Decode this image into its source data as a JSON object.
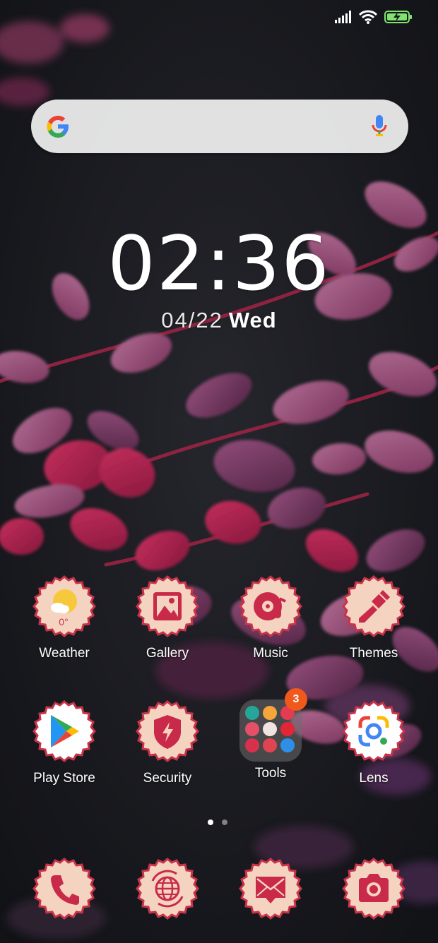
{
  "status_bar": {
    "icons": [
      "signal-icon",
      "wifi-icon",
      "battery-charging-icon"
    ]
  },
  "search": {
    "placeholder": "",
    "logo": "google-g-icon",
    "mic": "mic-icon"
  },
  "clock": {
    "hours": "02",
    "separator": ":",
    "minutes": "36"
  },
  "date": {
    "date": "04/22",
    "weekday": "Wed"
  },
  "weather": {
    "temperature": "0°"
  },
  "apps_row1": [
    {
      "label": "Weather",
      "icon": "weather-icon"
    },
    {
      "label": "Gallery",
      "icon": "gallery-icon"
    },
    {
      "label": "Music",
      "icon": "music-icon"
    },
    {
      "label": "Themes",
      "icon": "themes-brush-icon"
    }
  ],
  "apps_row2": [
    {
      "label": "Play Store",
      "icon": "play-store-icon"
    },
    {
      "label": "Security",
      "icon": "security-shield-icon"
    },
    {
      "label": "Tools",
      "icon": "folder-icon",
      "badge": "3"
    },
    {
      "label": "Lens",
      "icon": "lens-icon"
    }
  ],
  "dock": [
    {
      "icon": "phone-icon"
    },
    {
      "icon": "browser-globe-icon"
    },
    {
      "icon": "messaging-icon"
    },
    {
      "icon": "camera-icon"
    }
  ],
  "page_indicator": {
    "pages": 2,
    "current": 1
  },
  "colors": {
    "icon_face": "#f4d4c0",
    "icon_ring": "#c8334a",
    "icon_glyph": "#c92a4a",
    "badge": "#f0581c"
  }
}
